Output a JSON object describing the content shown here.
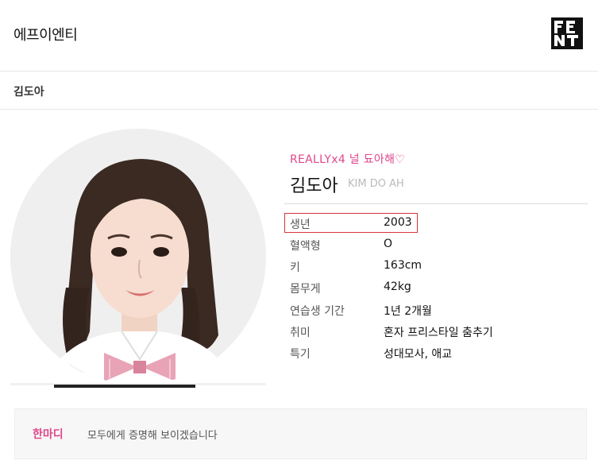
{
  "header": {
    "agency": "에프이엔티",
    "logo_icon": "fnt-logo"
  },
  "breadcrumb": {
    "current": "김도아"
  },
  "profile": {
    "catchphrase": "REALLYx4 널 됴아해♡",
    "name_ko": "김도아",
    "name_en": "KIM DO AH",
    "rows": [
      {
        "label": "생년",
        "value": "2003"
      },
      {
        "label": "혈액형",
        "value": "O"
      },
      {
        "label": "키",
        "value": "163cm"
      },
      {
        "label": "몸무게",
        "value": "42kg"
      },
      {
        "label": "연습생 기간",
        "value": "1년 2개월"
      },
      {
        "label": "취미",
        "value": "혼자 프리스타일 춤추기"
      },
      {
        "label": "특기",
        "value": "성대모사, 애교"
      }
    ]
  },
  "comment": {
    "label": "한마디",
    "text": "모두에게 증명해 보이겠습니다"
  },
  "colors": {
    "accent": "#e0468c",
    "highlight_border": "#d9343a"
  }
}
